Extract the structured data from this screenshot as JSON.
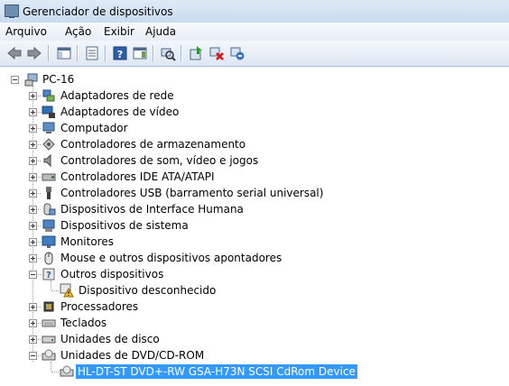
{
  "window": {
    "title": "Gerenciador de dispositivos",
    "icon": "device-manager-icon"
  },
  "menu": {
    "items": [
      "Arquivo",
      "Ação",
      "Exibir",
      "Ajuda"
    ]
  },
  "toolbar": {
    "buttons": [
      "back-icon",
      "forward-icon",
      "console-tree-icon",
      "properties-icon",
      "help-icon",
      "action-pane-icon",
      "scan-hardware-icon",
      "update-driver-icon",
      "disable-device-icon",
      "uninstall-device-icon"
    ]
  },
  "tree": {
    "root": {
      "label": "PC-16",
      "expanded": true
    },
    "categories": [
      {
        "label": "Adaptadores de rede",
        "icon": "network-adapter-icon",
        "expanded": false
      },
      {
        "label": "Adaptadores de vídeo",
        "icon": "display-adapter-icon",
        "expanded": false
      },
      {
        "label": "Computador",
        "icon": "computer-icon",
        "expanded": false
      },
      {
        "label": "Controladores de armazenamento",
        "icon": "storage-controller-icon",
        "expanded": false
      },
      {
        "label": "Controladores de som, vídeo e jogos",
        "icon": "speaker-icon",
        "expanded": false
      },
      {
        "label": "Controladores IDE ATA/ATAPI",
        "icon": "ide-controller-icon",
        "expanded": false
      },
      {
        "label": "Controladores USB (barramento serial universal)",
        "icon": "usb-icon",
        "expanded": false
      },
      {
        "label": "Dispositivos de Interface Humana",
        "icon": "hid-icon",
        "expanded": false
      },
      {
        "label": "Dispositivos de sistema",
        "icon": "system-device-icon",
        "expanded": false
      },
      {
        "label": "Monitores",
        "icon": "monitor-icon",
        "expanded": false
      },
      {
        "label": "Mouse e outros dispositivos apontadores",
        "icon": "mouse-icon",
        "expanded": false
      },
      {
        "label": "Outros dispositivos",
        "icon": "unknown-device-icon",
        "expanded": true,
        "children": [
          {
            "label": "Dispositivo desconhecido",
            "icon": "warning-device-icon"
          }
        ]
      },
      {
        "label": "Processadores",
        "icon": "processor-icon",
        "expanded": false
      },
      {
        "label": "Teclados",
        "icon": "keyboard-icon",
        "expanded": false
      },
      {
        "label": "Unidades de disco",
        "icon": "disk-drive-icon",
        "expanded": false
      },
      {
        "label": "Unidades de DVD/CD-ROM",
        "icon": "dvd-drive-icon",
        "expanded": true,
        "children": [
          {
            "label": "HL-DT-ST DVD+-RW GSA-H73N SCSI CdRom Device",
            "icon": "dvd-drive-icon",
            "selected": true
          }
        ]
      }
    ]
  },
  "colors": {
    "selection": "#3399ff",
    "titlebar": "#c9dbf0",
    "toolbar": "#dde7f3"
  }
}
